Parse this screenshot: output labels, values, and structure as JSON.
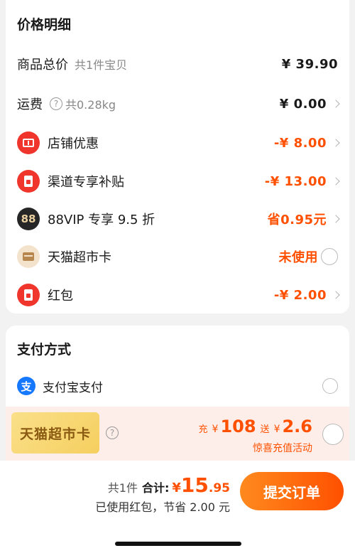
{
  "price_section": {
    "title": "价格明细",
    "total": {
      "label": "商品总价",
      "sub": "共1件宝贝",
      "value": "¥ 39.90"
    },
    "shipping": {
      "label": "运费",
      "help": "?",
      "sub": "共0.28kg",
      "value": "¥ 0.00"
    },
    "store_discount": {
      "label": "店铺优惠",
      "value": "-¥ 8.00"
    },
    "channel_subsidy": {
      "label": "渠道专享补贴",
      "value": "-¥ 13.00"
    },
    "vip": {
      "badge": "88",
      "label": "88VIP 专享 9.5 折",
      "value": "省0.95元"
    },
    "market_card": {
      "label": "天猫超市卡",
      "value": "未使用"
    },
    "red_packet": {
      "label": "红包",
      "value": "-¥ 2.00"
    }
  },
  "payment_section": {
    "title": "支付方式",
    "alipay": {
      "icon_text": "支",
      "label": "支付宝支付"
    },
    "tmall_card": {
      "card_text": "天猫超市卡",
      "help": "?",
      "recharge_prefix": "充",
      "currency": "¥",
      "recharge_amount": "108",
      "bonus_prefix": "送",
      "bonus_amount": "2.6",
      "promo": "惊喜充值活动"
    }
  },
  "footer": {
    "count": "共1件",
    "total_label": "合计:",
    "currency": "¥",
    "total_int": "15",
    "total_dec": ".95",
    "saved": "已使用红包，节省 2.00 元",
    "submit": "提交订单"
  },
  "colors": {
    "accent": "#ff5000",
    "alipay": "#1677ff",
    "red_icon": "#f0362c"
  },
  "icons": [
    "ticket-icon",
    "red-envelope-icon",
    "vip-88-icon",
    "card-icon",
    "alipay-icon",
    "help-icon",
    "chevron-right-icon"
  ]
}
